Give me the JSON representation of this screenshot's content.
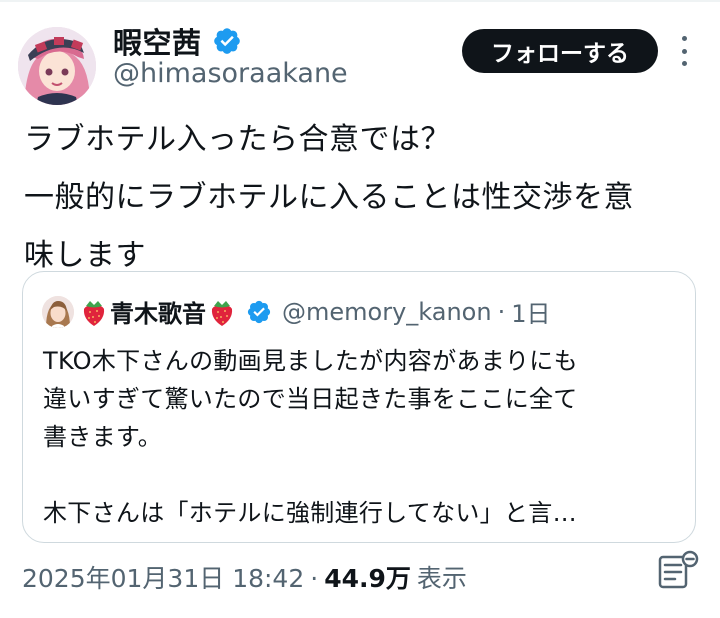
{
  "tweet": {
    "author": {
      "display_name": "暇空茜",
      "handle": "@himasoraakane",
      "verified_icon": "verified-badge-icon"
    },
    "follow_label": "フォローする",
    "text_lines": [
      "ラブホテル入ったら合意では？",
      "一般的にラブホテルに入ることは性交渉を意",
      "味します"
    ],
    "quote": {
      "display_name": "青木歌音",
      "handle": "@memory_kanon",
      "separator": "·",
      "time": "1日",
      "text_lines": [
        "TKO木下さんの動画見ましたが内容があまりにも",
        "違いすぎて驚いたので当日起きた事をここに全て",
        "書きます。",
        "",
        "木下さんは「ホテルに強制連行してない」と言…"
      ]
    },
    "meta": {
      "timestamp": "2025年01月31日 18:42",
      "separator": "·",
      "views_count": "44.9万",
      "views_label": "表示"
    }
  },
  "colors": {
    "text": "#0f1419",
    "secondary": "#536471",
    "verified_blue": "#1d9bf0",
    "border": "#cfd9de",
    "follow_bg": "#0f1419"
  }
}
